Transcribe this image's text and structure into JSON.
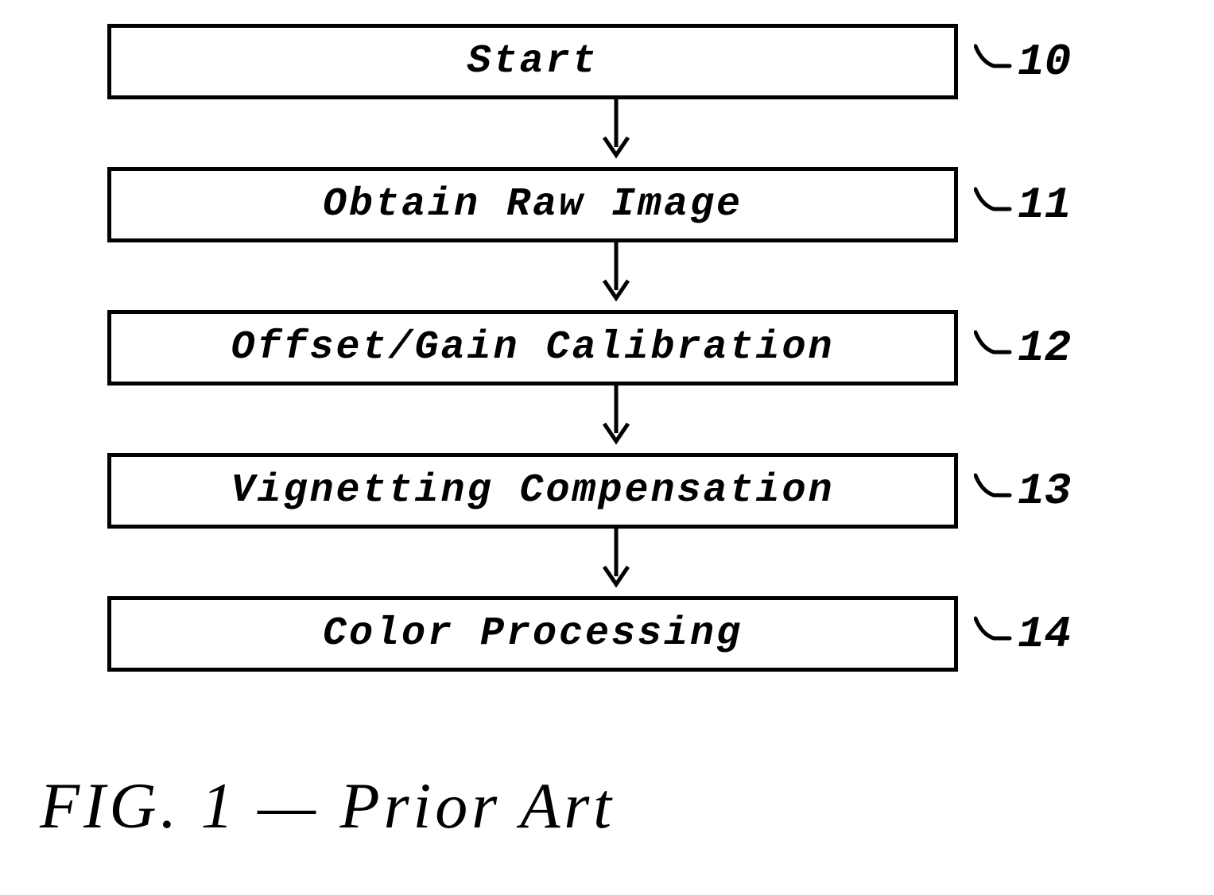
{
  "flowchart": {
    "steps": [
      {
        "label": "Start",
        "num": "10"
      },
      {
        "label": "Obtain Raw Image",
        "num": "11"
      },
      {
        "label": "Offset/Gain Calibration",
        "num": "12"
      },
      {
        "label": "Vignetting Compensation",
        "num": "13"
      },
      {
        "label": "Color Processing",
        "num": "14"
      }
    ]
  },
  "caption": "FIG. 1 — Prior Art"
}
